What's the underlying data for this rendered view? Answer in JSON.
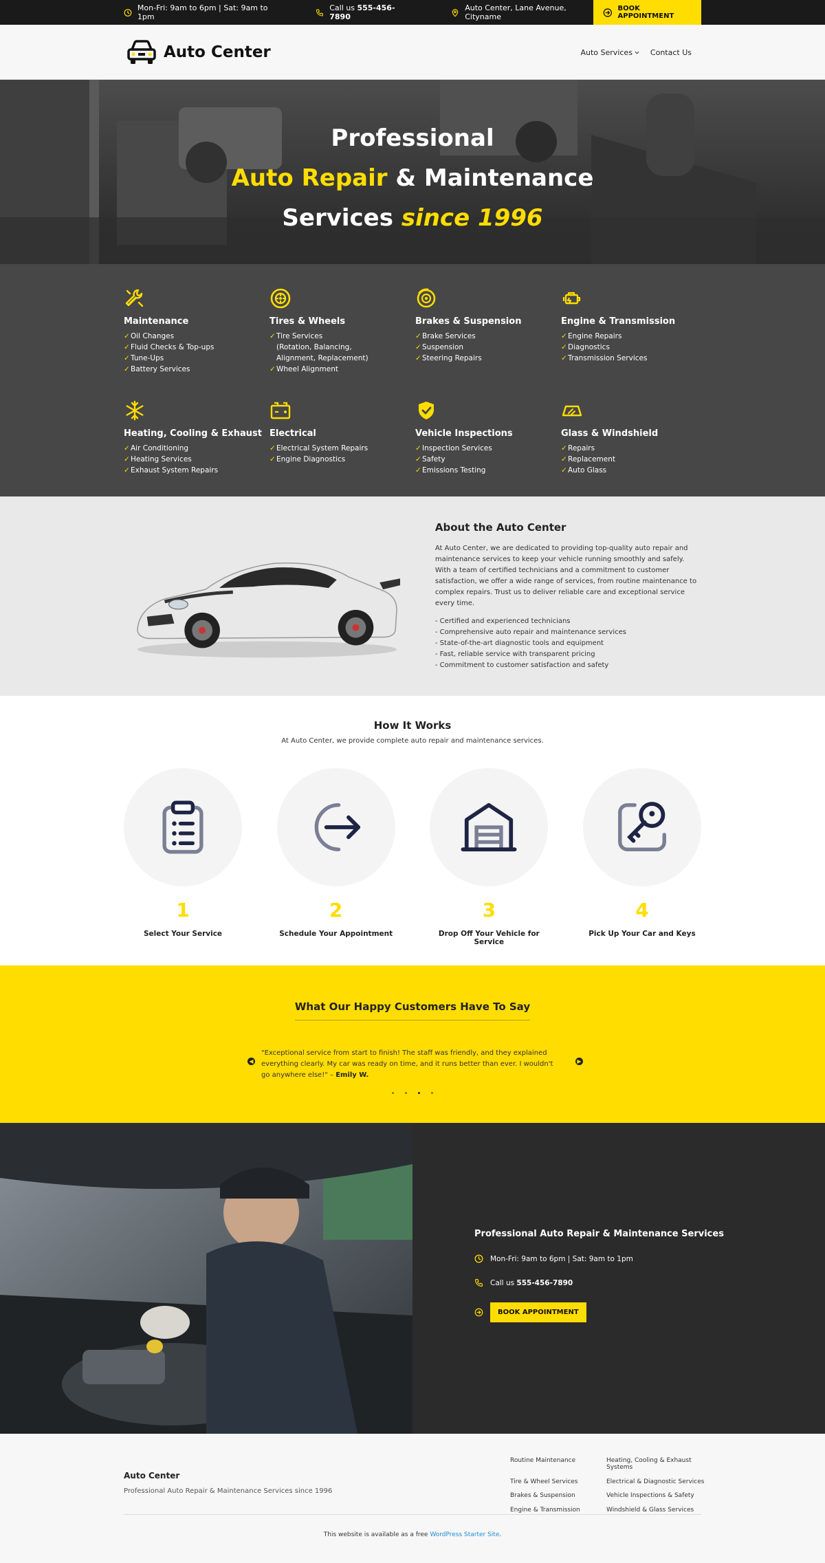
{
  "topbar": {
    "hours": "Mon-Fri: 9am to 6pm | Sat: 9am to 1pm",
    "phone_prefix": "Call us ",
    "phone": "555-456-7890",
    "address": "Auto Center, Lane Avenue, Cityname",
    "book_label": "BOOK APPOINTMENT"
  },
  "header": {
    "logo_text": "Auto Center",
    "nav": [
      "Auto Services",
      "Contact Us"
    ]
  },
  "hero": {
    "line1": "Professional",
    "line2_hl": "Auto Repair",
    "line2_rest": " & Maintenance",
    "line3_main": "Services ",
    "line3_it": "since 1996"
  },
  "services": [
    {
      "title": "Maintenance",
      "icon": "wrench-icon",
      "items": [
        "Oil Changes",
        "Fluid Checks & Top-ups",
        "Tune-Ups",
        "Battery Services"
      ]
    },
    {
      "title": "Tires & Wheels",
      "icon": "tire-icon",
      "items": [
        "Tire Services",
        "(Rotation, Balancing,",
        "Alignment, Replacement)",
        "Wheel Alignment"
      ]
    },
    {
      "title": "Brakes & Suspension",
      "icon": "brake-disc-icon",
      "items": [
        "Brake Services",
        "Suspension",
        "Steering Repairs"
      ]
    },
    {
      "title": "Engine & Transmission",
      "icon": "engine-icon",
      "items": [
        "Engine Repairs",
        "Diagnostics",
        "Transmission Services"
      ]
    },
    {
      "title": "Heating, Cooling & Exhaust",
      "icon": "snowflake-icon",
      "items": [
        "Air Conditioning",
        "Heating Services",
        "Exhaust System Repairs"
      ]
    },
    {
      "title": "Electrical",
      "icon": "battery-icon",
      "items": [
        "Electrical System Repairs",
        "Engine Diagnostics"
      ]
    },
    {
      "title": "Vehicle Inspections",
      "icon": "shield-check-icon",
      "items": [
        "Inspection Services",
        "Safety",
        "Emissions Testing"
      ]
    },
    {
      "title": "Glass & Windshield",
      "icon": "windshield-icon",
      "items": [
        "Repairs",
        "Replacement",
        "Auto Glass"
      ]
    }
  ],
  "about": {
    "title": "About the Auto Center",
    "body": "At Auto Center, we are dedicated to providing top-quality auto repair and maintenance services to keep your vehicle running smoothly and safely. With a team of certified technicians and a commitment to customer satisfaction, we offer a wide range of services, from routine maintenance to complex repairs. Trust us to deliver reliable care and exceptional service every time.",
    "points": [
      "- Certified and experienced technicians",
      "- Comprehensive auto repair and maintenance services",
      "- State-of-the-art diagnostic tools and equipment",
      "- Fast, reliable service with transparent pricing",
      "- Commitment to customer satisfaction and safety"
    ]
  },
  "how": {
    "title": "How It Works",
    "subtitle": "At Auto Center, we provide complete auto repair and maintenance services.",
    "steps": [
      {
        "num": "1",
        "label": "Select Your Service"
      },
      {
        "num": "2",
        "label": "Schedule Your Appointment"
      },
      {
        "num": "3",
        "label": "Drop Off Your Vehicle for Service"
      },
      {
        "num": "4",
        "label": "Pick Up Your Car and Keys"
      }
    ]
  },
  "testimonials": {
    "title": "What Our Happy Customers Have To Say",
    "quote": "\"Exceptional service from start to finish! The staff was friendly, and they explained everything clearly. My car was ready on time, and it runs better than ever. I wouldn't go anywhere else!\" – ",
    "author": "Emily W.",
    "active_index": 2
  },
  "cta": {
    "title": "Professional Auto Repair & Maintenance Services",
    "hours": "Mon-Fri: 9am to 6pm | Sat: 9am to 1pm",
    "phone_prefix": "Call us ",
    "phone": "555-456-7890",
    "book_label": "BOOK APPOINTMENT"
  },
  "footer": {
    "brand": "Auto Center",
    "tagline": "Professional Auto Repair & Maintenance Services since 1996",
    "links": [
      "Routine Maintenance",
      "Heating, Cooling & Exhaust Systems",
      "Tire & Wheel Services",
      "Electrical & Diagnostic Services",
      "Brakes & Suspension",
      "Vehicle Inspections & Safety",
      "Engine & Transmission",
      "Windshield & Glass Services"
    ],
    "credit_prefix": "This website is available as a free ",
    "credit_link": "WordPress Starter Site",
    "credit_suffix": "."
  },
  "colors": {
    "accent": "#ffdd00",
    "dark": "#1a1a1a",
    "services_bg": "#474747",
    "link": "#1a8fd6"
  }
}
